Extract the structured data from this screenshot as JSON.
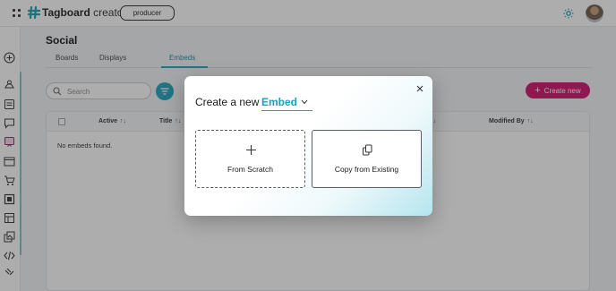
{
  "app": {
    "brand_bold": "Tagboard",
    "brand_light": "creator",
    "role": "producer"
  },
  "page": {
    "title": "Social"
  },
  "tabs": [
    {
      "label": "Boards"
    },
    {
      "label": "Displays"
    },
    {
      "label": "Embeds",
      "active": true
    }
  ],
  "toolbar": {
    "search_placeholder": "Search",
    "create_label": "Create new",
    "create_icon": "+"
  },
  "table": {
    "headers": [
      "Active",
      "Title",
      "Modified By"
    ],
    "sort_glyph": "↑↓",
    "empty_message": "No embeds found."
  },
  "modal": {
    "title": "Create a new",
    "type_value": "Embed",
    "options": [
      {
        "label": "From Scratch",
        "icon": "plus-icon"
      },
      {
        "label": "Copy from Existing",
        "icon": "copy-icon"
      }
    ]
  },
  "colors": {
    "accent": "#1ea3bb",
    "brand_button": "#cf0f6b"
  }
}
